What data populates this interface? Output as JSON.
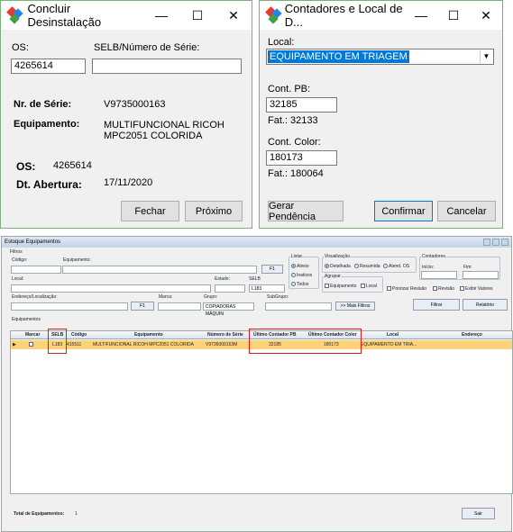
{
  "dialog1": {
    "title": "Concluir Desinstalação",
    "os_label": "OS:",
    "os_value": "4265614",
    "selb_label": "SELB/Número de Série:",
    "selb_value": "",
    "serie_label": "Nr. de Série:",
    "serie_value": "V9735000163",
    "equip_label": "Equipamento:",
    "equip_value_1": "MULTIFUNCIONAL RICOH",
    "equip_value_2": "MPC2051 COLORIDA",
    "os2_label": "OS:",
    "os2_value": "4265614",
    "abertura_label": "Dt. Abertura:",
    "abertura_value": "17/11/2020",
    "fechar": "Fechar",
    "proximo": "Próximo"
  },
  "dialog2": {
    "title": "Contadores e Local de D...",
    "local_label": "Local:",
    "local_value": "EQUIPAMENTO EM TRIAGEM",
    "pb_label": "Cont. PB:",
    "pb_value": "32185",
    "pb_fat": "Fat.: 32133",
    "color_label": "Cont. Color:",
    "color_value": "180173",
    "color_fat": "Fat.: 180064",
    "gerar": "Gerar Pendência",
    "confirmar": "Confirmar",
    "cancelar": "Cancelar"
  },
  "window_controls": {
    "minimize": "—",
    "maximize": "☐",
    "close": "✕"
  },
  "estoque": {
    "title": "Estoque Equipamentos",
    "filtros": "Filtros",
    "codigo": "Código:",
    "equipamento": "Equipamento:",
    "f1": "F1",
    "local": "Local:",
    "estado": "Estado:",
    "selb": "SELB",
    "selb_value": "L183",
    "endereco": "Endereço/Localização:",
    "marca": "Marca:",
    "grupo": "Grupo:",
    "grupo_value": "COPIADORAS MÁQUIN",
    "subgrupo": "SubGrupo:",
    "mais_filtros": ">> Mais Filtros",
    "listar": "Listar",
    "listar_opts": [
      "Ativos",
      "Inativos",
      "Todos"
    ],
    "visualizacao": "Visualização",
    "vis_opts": [
      "Detalhada",
      "Resumida",
      "Atend. OS"
    ],
    "agrupar": "Agrupar",
    "agrupar_opts": [
      "Equipamento",
      "Local"
    ],
    "priorizar": "Priorizar Revisão",
    "revisao": "Revisão",
    "exibir": "Exibir Valores",
    "contadores": "Contadores",
    "inicio": "Início:",
    "fim": "Fim:",
    "filtrar": "Filtrar",
    "relatorio": "Relatório",
    "tab": "Equipamentos",
    "columns": [
      "Marcar",
      "SELB",
      "Código",
      "Equipamento",
      "Número de Série",
      "Último Contador PB",
      "Último Contador Color",
      "Local",
      "Endereço"
    ],
    "row": {
      "selb": "L183",
      "codigo": "415511",
      "equipamento": "MULTIFUNCIONAL RICOH MPC2051 COLORIDA",
      "serie": "V9735000163M",
      "pb": "32185",
      "color": "180173",
      "local": "EQUIPAMENTO EM TRIA..."
    },
    "total_label": "Total de Equipamentos:",
    "total_value": "1",
    "sair": "Sair"
  }
}
